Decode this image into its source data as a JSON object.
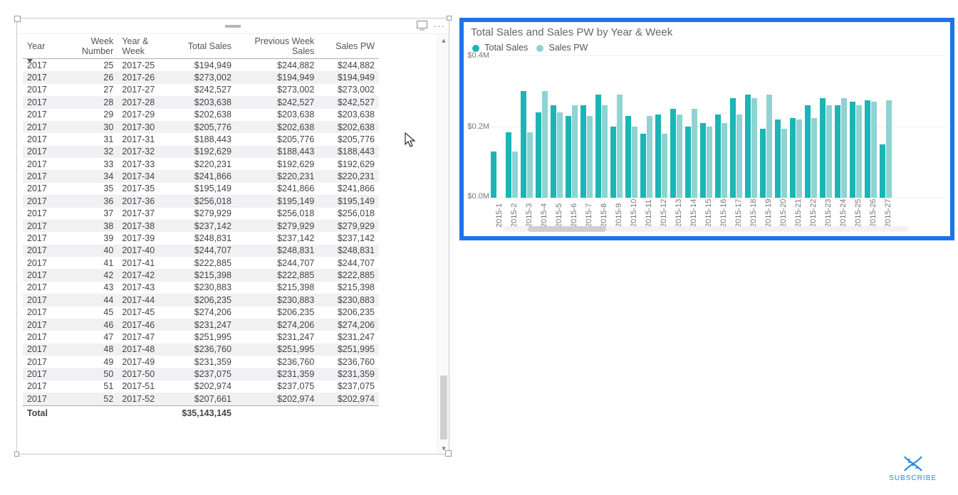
{
  "table": {
    "headers": [
      "Year",
      "Week Number",
      "Year & Week",
      "Total Sales",
      "Previous Week Sales",
      "Sales PW"
    ],
    "rows": [
      {
        "year": "2017",
        "week": "25",
        "yw": "2017-25",
        "ts": "$194,949",
        "pw": "$244,882",
        "spw": "$244,882"
      },
      {
        "year": "2017",
        "week": "26",
        "yw": "2017-26",
        "ts": "$273,002",
        "pw": "$194,949",
        "spw": "$194,949"
      },
      {
        "year": "2017",
        "week": "27",
        "yw": "2017-27",
        "ts": "$242,527",
        "pw": "$273,002",
        "spw": "$273,002"
      },
      {
        "year": "2017",
        "week": "28",
        "yw": "2017-28",
        "ts": "$203,638",
        "pw": "$242,527",
        "spw": "$242,527"
      },
      {
        "year": "2017",
        "week": "29",
        "yw": "2017-29",
        "ts": "$202,638",
        "pw": "$203,638",
        "spw": "$203,638"
      },
      {
        "year": "2017",
        "week": "30",
        "yw": "2017-30",
        "ts": "$205,776",
        "pw": "$202,638",
        "spw": "$202,638"
      },
      {
        "year": "2017",
        "week": "31",
        "yw": "2017-31",
        "ts": "$188,443",
        "pw": "$205,776",
        "spw": "$205,776"
      },
      {
        "year": "2017",
        "week": "32",
        "yw": "2017-32",
        "ts": "$192,629",
        "pw": "$188,443",
        "spw": "$188,443"
      },
      {
        "year": "2017",
        "week": "33",
        "yw": "2017-33",
        "ts": "$220,231",
        "pw": "$192,629",
        "spw": "$192,629"
      },
      {
        "year": "2017",
        "week": "34",
        "yw": "2017-34",
        "ts": "$241,866",
        "pw": "$220,231",
        "spw": "$220,231"
      },
      {
        "year": "2017",
        "week": "35",
        "yw": "2017-35",
        "ts": "$195,149",
        "pw": "$241,866",
        "spw": "$241,866"
      },
      {
        "year": "2017",
        "week": "36",
        "yw": "2017-36",
        "ts": "$256,018",
        "pw": "$195,149",
        "spw": "$195,149"
      },
      {
        "year": "2017",
        "week": "37",
        "yw": "2017-37",
        "ts": "$279,929",
        "pw": "$256,018",
        "spw": "$256,018"
      },
      {
        "year": "2017",
        "week": "38",
        "yw": "2017-38",
        "ts": "$237,142",
        "pw": "$279,929",
        "spw": "$279,929"
      },
      {
        "year": "2017",
        "week": "39",
        "yw": "2017-39",
        "ts": "$248,831",
        "pw": "$237,142",
        "spw": "$237,142"
      },
      {
        "year": "2017",
        "week": "40",
        "yw": "2017-40",
        "ts": "$244,707",
        "pw": "$248,831",
        "spw": "$248,831"
      },
      {
        "year": "2017",
        "week": "41",
        "yw": "2017-41",
        "ts": "$222,885",
        "pw": "$244,707",
        "spw": "$244,707"
      },
      {
        "year": "2017",
        "week": "42",
        "yw": "2017-42",
        "ts": "$215,398",
        "pw": "$222,885",
        "spw": "$222,885"
      },
      {
        "year": "2017",
        "week": "43",
        "yw": "2017-43",
        "ts": "$230,883",
        "pw": "$215,398",
        "spw": "$215,398"
      },
      {
        "year": "2017",
        "week": "44",
        "yw": "2017-44",
        "ts": "$206,235",
        "pw": "$230,883",
        "spw": "$230,883"
      },
      {
        "year": "2017",
        "week": "45",
        "yw": "2017-45",
        "ts": "$274,206",
        "pw": "$206,235",
        "spw": "$206,235"
      },
      {
        "year": "2017",
        "week": "46",
        "yw": "2017-46",
        "ts": "$231,247",
        "pw": "$274,206",
        "spw": "$274,206"
      },
      {
        "year": "2017",
        "week": "47",
        "yw": "2017-47",
        "ts": "$251,995",
        "pw": "$231,247",
        "spw": "$231,247"
      },
      {
        "year": "2017",
        "week": "48",
        "yw": "2017-48",
        "ts": "$236,760",
        "pw": "$251,995",
        "spw": "$251,995"
      },
      {
        "year": "2017",
        "week": "49",
        "yw": "2017-49",
        "ts": "$231,359",
        "pw": "$236,760",
        "spw": "$236,760"
      },
      {
        "year": "2017",
        "week": "50",
        "yw": "2017-50",
        "ts": "$237,075",
        "pw": "$231,359",
        "spw": "$231,359"
      },
      {
        "year": "2017",
        "week": "51",
        "yw": "2017-51",
        "ts": "$202,974",
        "pw": "$237,075",
        "spw": "$237,075"
      },
      {
        "year": "2017",
        "week": "52",
        "yw": "2017-52",
        "ts": "$207,661",
        "pw": "$202,974",
        "spw": "$202,974"
      }
    ],
    "totalLabel": "Total",
    "grandTotal": "$35,143,145"
  },
  "chart": {
    "title": "Total Sales and Sales PW by Year & Week",
    "legend": [
      "Total Sales",
      "Sales PW"
    ],
    "yTicks": [
      "$0.4M",
      "$0.2M",
      "$0.0M"
    ]
  },
  "subscribe": {
    "label": "SUBSCRIBE"
  },
  "chart_data": {
    "type": "bar",
    "title": "Total Sales and Sales PW by Year & Week",
    "xlabel": "Year & Week",
    "ylabel": "",
    "ylim": [
      0,
      400000
    ],
    "yticks": [
      0,
      200000,
      400000
    ],
    "categories": [
      "2015-1",
      "2015-2",
      "2015-3",
      "2015-4",
      "2015-5",
      "2015-6",
      "2015-7",
      "2015-8",
      "2015-9",
      "2015-10",
      "2015-11",
      "2015-12",
      "2015-13",
      "2015-14",
      "2015-15",
      "2015-16",
      "2015-17",
      "2015-18",
      "2015-19",
      "2015-20",
      "2015-21",
      "2015-22",
      "2015-23",
      "2015-24",
      "2015-25",
      "2015-26",
      "2015-27"
    ],
    "series": [
      {
        "name": "Total Sales",
        "color": "#1cb5b5",
        "values": [
          130000,
          185000,
          300000,
          240000,
          260000,
          230000,
          260000,
          290000,
          200000,
          230000,
          180000,
          235000,
          250000,
          200000,
          210000,
          235000,
          280000,
          290000,
          195000,
          220000,
          225000,
          260000,
          280000,
          260000,
          270000,
          275000,
          150000
        ]
      },
      {
        "name": "Sales PW",
        "color": "#8fd3d3",
        "values": [
          null,
          130000,
          185000,
          300000,
          240000,
          260000,
          230000,
          260000,
          290000,
          200000,
          230000,
          180000,
          235000,
          250000,
          200000,
          210000,
          235000,
          280000,
          290000,
          195000,
          220000,
          225000,
          260000,
          280000,
          260000,
          270000,
          275000
        ]
      }
    ]
  }
}
